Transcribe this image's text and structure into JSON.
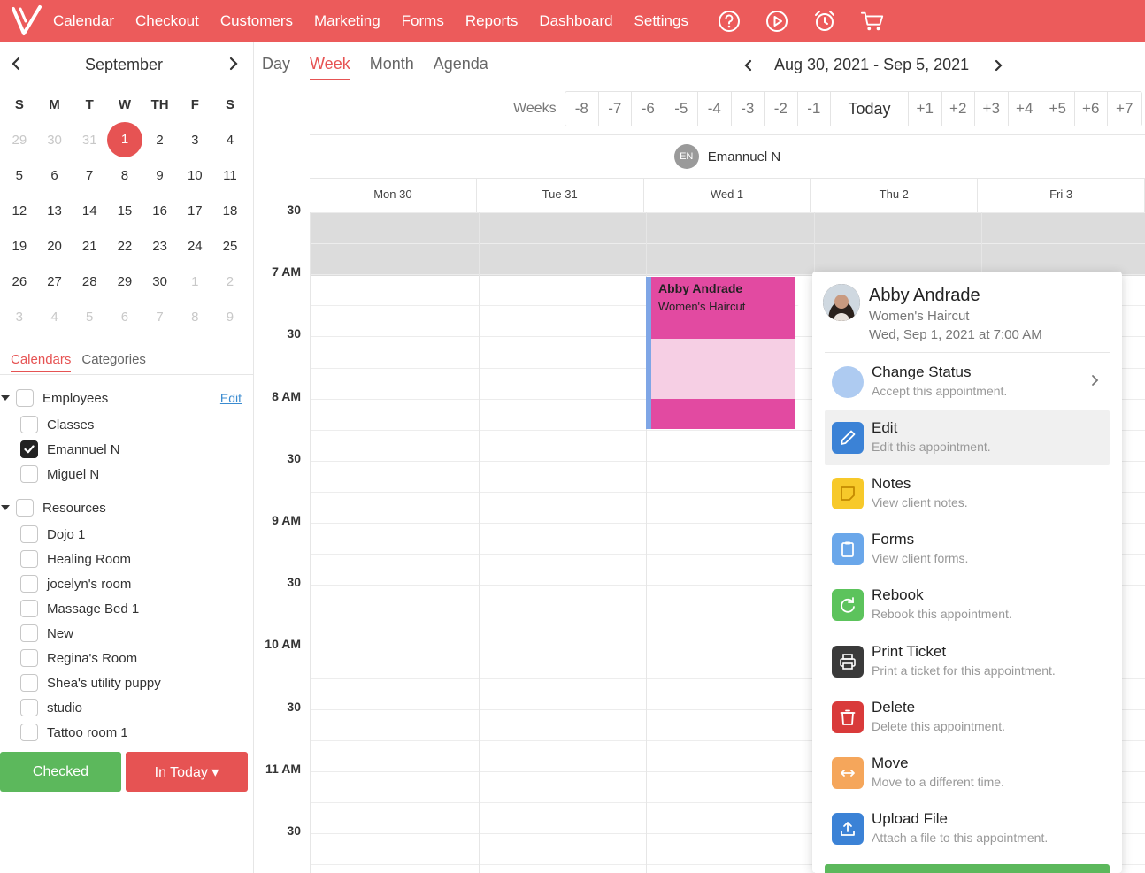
{
  "nav": {
    "items": [
      "Calendar",
      "Checkout",
      "Customers",
      "Marketing",
      "Forms",
      "Reports",
      "Dashboard",
      "Settings"
    ],
    "icons": [
      "help-icon",
      "play-icon",
      "alarm-clock-icon",
      "cart-icon"
    ],
    "color": "#ec5b5b"
  },
  "mini_calendar": {
    "month": "September",
    "dow": [
      "S",
      "M",
      "T",
      "W",
      "TH",
      "F",
      "S"
    ],
    "weeks": [
      [
        [
          "29",
          "muted"
        ],
        [
          "30",
          "muted"
        ],
        [
          "31",
          "muted"
        ],
        [
          "1",
          "today"
        ],
        [
          "2",
          ""
        ],
        [
          "3",
          ""
        ],
        [
          "4",
          ""
        ]
      ],
      [
        [
          "5",
          ""
        ],
        [
          "6",
          ""
        ],
        [
          "7",
          ""
        ],
        [
          "8",
          ""
        ],
        [
          "9",
          ""
        ],
        [
          "10",
          ""
        ],
        [
          "11",
          ""
        ]
      ],
      [
        [
          "12",
          ""
        ],
        [
          "13",
          ""
        ],
        [
          "14",
          ""
        ],
        [
          "15",
          ""
        ],
        [
          "16",
          ""
        ],
        [
          "17",
          ""
        ],
        [
          "18",
          ""
        ]
      ],
      [
        [
          "19",
          ""
        ],
        [
          "20",
          ""
        ],
        [
          "21",
          ""
        ],
        [
          "22",
          ""
        ],
        [
          "23",
          ""
        ],
        [
          "24",
          ""
        ],
        [
          "25",
          ""
        ]
      ],
      [
        [
          "26",
          ""
        ],
        [
          "27",
          ""
        ],
        [
          "28",
          ""
        ],
        [
          "29",
          ""
        ],
        [
          "30",
          ""
        ],
        [
          "1",
          "muted"
        ],
        [
          "2",
          "muted"
        ]
      ],
      [
        [
          "3",
          "muted"
        ],
        [
          "4",
          "muted"
        ],
        [
          "5",
          "muted"
        ],
        [
          "6",
          "muted"
        ],
        [
          "7",
          "muted"
        ],
        [
          "8",
          "muted"
        ],
        [
          "9",
          "muted"
        ]
      ]
    ]
  },
  "cal_tabs": {
    "calendars": "Calendars",
    "categories": "Categories"
  },
  "employees": {
    "label": "Employees",
    "edit": "Edit",
    "items": [
      {
        "label": "Classes",
        "checked": false
      },
      {
        "label": "Emannuel N",
        "checked": true
      },
      {
        "label": "Miguel N",
        "checked": false
      }
    ]
  },
  "resources": {
    "label": "Resources",
    "items": [
      "Dojo 1",
      "Healing Room",
      "jocelyn's room",
      "Massage Bed 1",
      "New",
      "Regina's Room",
      "Shea's utility puppy",
      "studio",
      "Tattoo room 1"
    ]
  },
  "buttons": {
    "checked": "Checked",
    "in_today": "In Today ▾"
  },
  "views": {
    "day": "Day",
    "week": "Week",
    "month": "Month",
    "agenda": "Agenda"
  },
  "range": "Aug 30, 2021 - Sep 5, 2021",
  "weeks": {
    "label": "Weeks",
    "minus": [
      "-8",
      "-7",
      "-6",
      "-5",
      "-4",
      "-3",
      "-2",
      "-1"
    ],
    "today": "Today",
    "plus": [
      "+1",
      "+2",
      "+3",
      "+4",
      "+5",
      "+6",
      "+7"
    ]
  },
  "staff": {
    "initials": "EN",
    "name": "Emannuel N"
  },
  "days": [
    "Mon 30",
    "Tue 31",
    "Wed 1",
    "Thu 2",
    "Fri 3"
  ],
  "times": [
    "30",
    "7 AM",
    "30",
    "8 AM",
    "30",
    "9 AM",
    "30",
    "10 AM",
    "30",
    "11 AM",
    "30"
  ],
  "appointment": {
    "name": "Abby Andrade",
    "service": "Women's Haircut",
    "color": "#e24aa1"
  },
  "popup": {
    "name": "Abby Andrade",
    "service": "Women's Haircut",
    "when": "Wed, Sep 1, 2021 at 7:00 AM",
    "actions": [
      {
        "title": "Change Status",
        "sub": "Accept this appointment.",
        "icon": "status-circle-icon",
        "color": "#aecbf1"
      },
      {
        "title": "Edit",
        "sub": "Edit this appointment.",
        "icon": "pencil-icon",
        "color": "#3b82d6"
      },
      {
        "title": "Notes",
        "sub": "View client notes.",
        "icon": "note-icon",
        "color": "#f7c92a"
      },
      {
        "title": "Forms",
        "sub": "View client forms.",
        "icon": "clipboard-icon",
        "color": "#6aa7ea"
      },
      {
        "title": "Rebook",
        "sub": "Rebook this appointment.",
        "icon": "rebook-icon",
        "color": "#5cc35c"
      },
      {
        "title": "Print Ticket",
        "sub": "Print a ticket for this appointment.",
        "icon": "printer-icon",
        "color": "#3a3a3a"
      },
      {
        "title": "Delete",
        "sub": "Delete this appointment.",
        "icon": "trash-icon",
        "color": "#d93a3a"
      },
      {
        "title": "Move",
        "sub": "Move to a different time.",
        "icon": "move-icon",
        "color": "#f5a65b"
      },
      {
        "title": "Upload File",
        "sub": "Attach a file to this appointment.",
        "icon": "upload-icon",
        "color": "#3b82d6"
      }
    ]
  }
}
